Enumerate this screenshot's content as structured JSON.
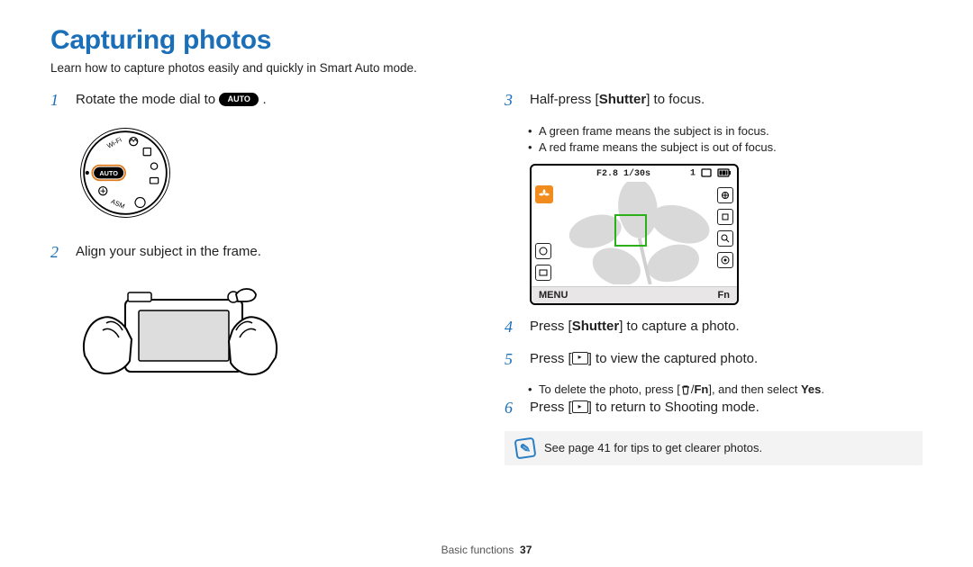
{
  "title": "Capturing photos",
  "subtitle": "Learn how to capture photos easily and quickly in Smart Auto mode.",
  "left": {
    "step1_pre": "Rotate the mode dial to ",
    "step1_auto": "AUTO",
    "step1_post": ".",
    "step2": "Align your subject in the frame."
  },
  "right": {
    "step3_pre": "Half-press [",
    "step3_shutter": "Shutter",
    "step3_post": "] to focus.",
    "step3_b1": "A green frame means the subject is in focus.",
    "step3_b2": "A red frame means the subject is out of focus.",
    "lcd": {
      "exposure": "F2.8  1/30s",
      "count": "1",
      "menu": "MENU",
      "fn": "Fn"
    },
    "step4_pre": "Press [",
    "step4_shutter": "Shutter",
    "step4_post": "] to capture a photo.",
    "step5_pre": "Press [",
    "step5_post": "] to view the captured photo.",
    "step5_b_pre": "To delete the photo, press [",
    "step5_b_mid": "], and then select ",
    "step5_b_yes": "Yes",
    "step5_b_post": ".",
    "step6_pre": "Press [",
    "step6_post": "] to return to Shooting mode.",
    "tip": "See page 41 for tips to get clearer photos."
  },
  "dial": {
    "wifi": "Wi-Fi",
    "asm": "ASM",
    "auto": "AUTO"
  },
  "fnlabel": "Fn",
  "footer_section": "Basic functions",
  "footer_page": "37"
}
